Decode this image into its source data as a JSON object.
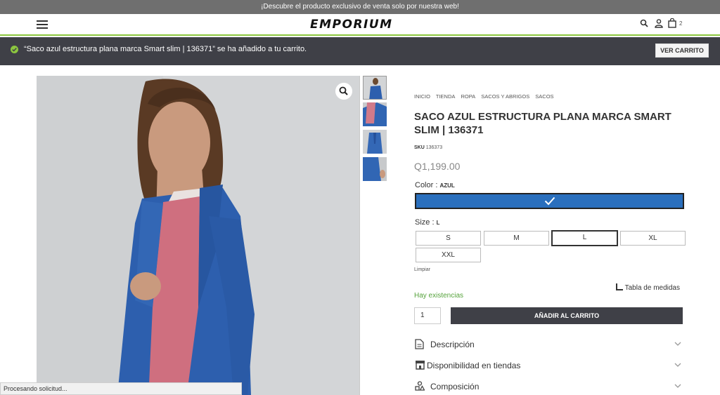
{
  "promo": {
    "text": "¡Descubre el producto exclusivo de venta solo por nuestra web!"
  },
  "header": {
    "logo": "EMPORIUM",
    "cart_count": "2",
    "icons": [
      "menu-icon",
      "search-icon",
      "user-icon",
      "bag-icon"
    ]
  },
  "notice": {
    "message": "“Saco azul estructura plana marca Smart slim | 136371” se ha añadido a tu carrito.",
    "button": "VER CARRITO"
  },
  "breadcrumb": [
    "INICIO",
    "TIENDA",
    "ROPA",
    "SACOS Y ABRIGOS",
    "SACOS"
  ],
  "product": {
    "title": "SACO AZUL ESTRUCTURA PLANA MARCA SMART SLIM | 136371",
    "sku_label": "SKU",
    "sku": "136373",
    "price": "Q1,199.00",
    "color_label": "Color",
    "color_value": "AZUL",
    "swatch_color": "#2a6fbd",
    "size_label": "Size",
    "size_value": "L",
    "sizes": [
      "S",
      "M",
      "L",
      "XL",
      "XXL"
    ],
    "selected_size": "L",
    "clear": "Limpiar",
    "size_chart": "Tabla de medidas",
    "stock": "Hay existencias",
    "quantity": "1",
    "add_to_cart": "AÑADIR AL CARRITO"
  },
  "accordion": [
    "Descripción",
    "Disponibilidad en tiendas",
    "Composición"
  ],
  "status_bar": "Procesando solicitud...",
  "colors": {
    "accent_green": "#8cc63f",
    "dark_bar": "#3f4047",
    "stock_green": "#56a33c"
  }
}
